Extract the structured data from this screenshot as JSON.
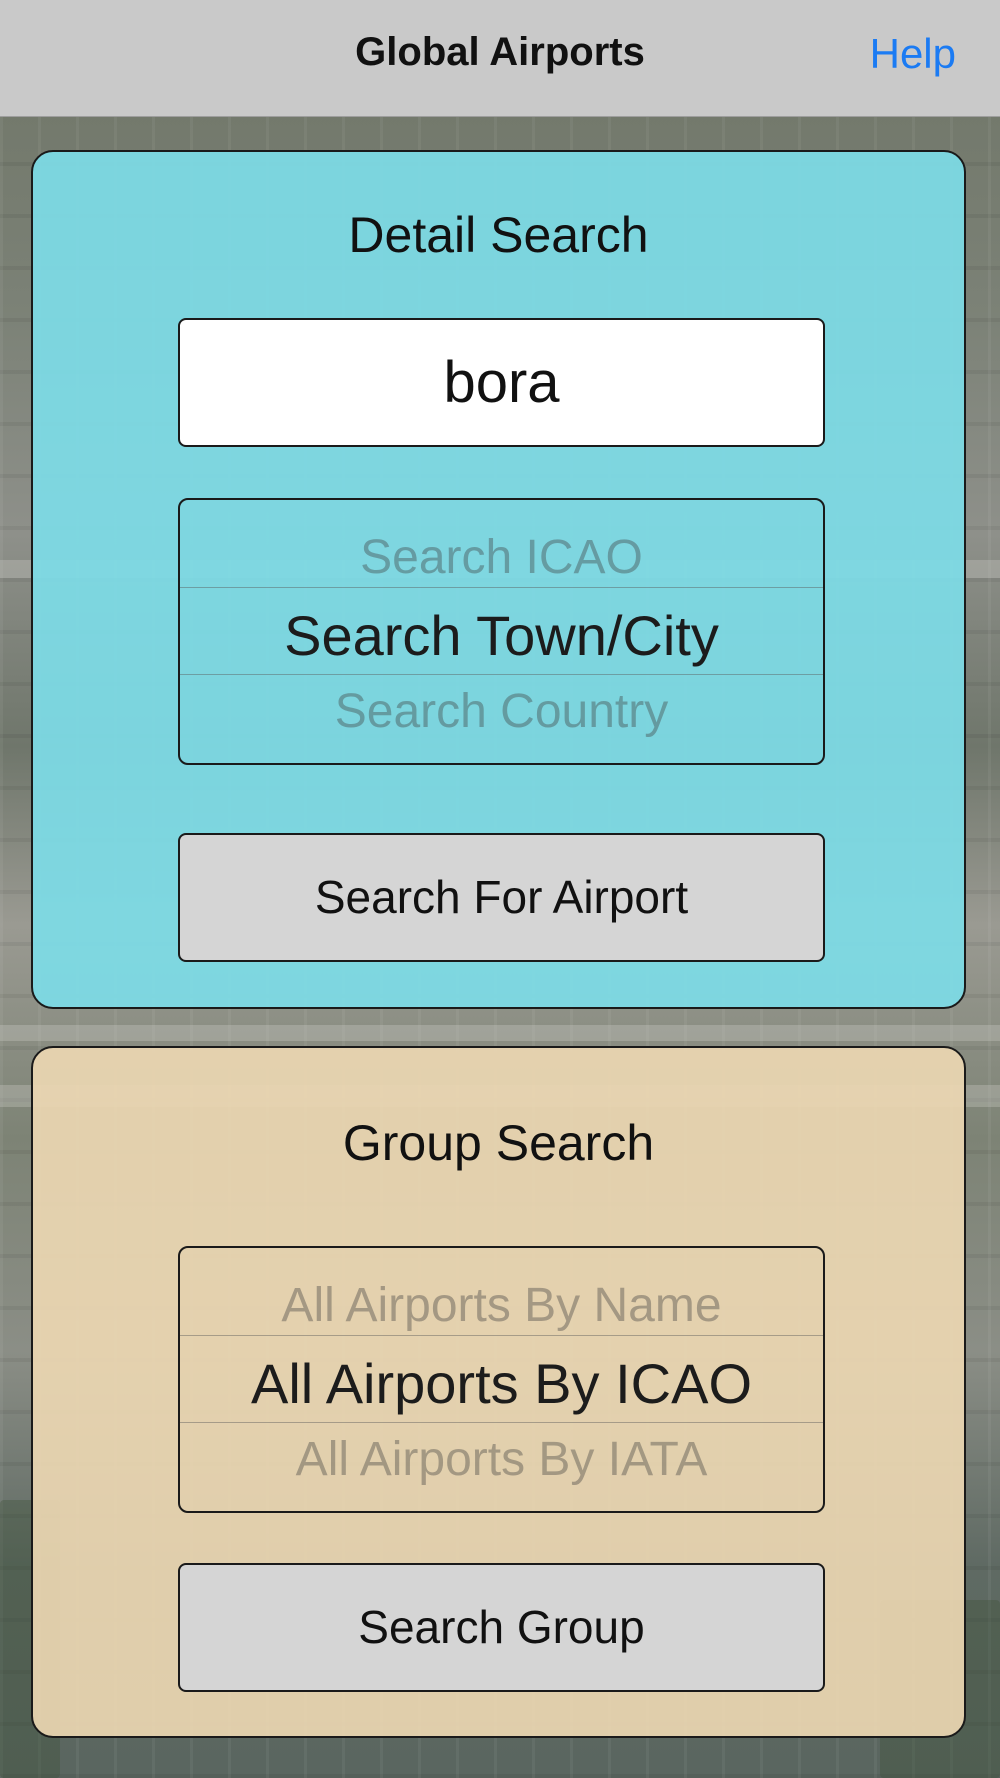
{
  "navbar": {
    "title": "Global Airports",
    "help_label": "Help"
  },
  "detail_search": {
    "heading": "Detail Search",
    "query_value": "bora",
    "picker": {
      "above": "Search ICAO",
      "selected": "Search Town/City",
      "below": "Search Country"
    },
    "button_label": "Search For Airport"
  },
  "group_search": {
    "heading": "Group Search",
    "picker": {
      "above": "All Airports By Name",
      "selected": "All Airports By ICAO",
      "below": "All Airports By IATA"
    },
    "button_label": "Search Group"
  },
  "colors": {
    "accent": "#1b7bf3",
    "detail_panel": "#7ddce6",
    "group_panel": "#ecd7b2",
    "button_fill": "#d5d5d5",
    "navbar": "#c9c9c9"
  }
}
